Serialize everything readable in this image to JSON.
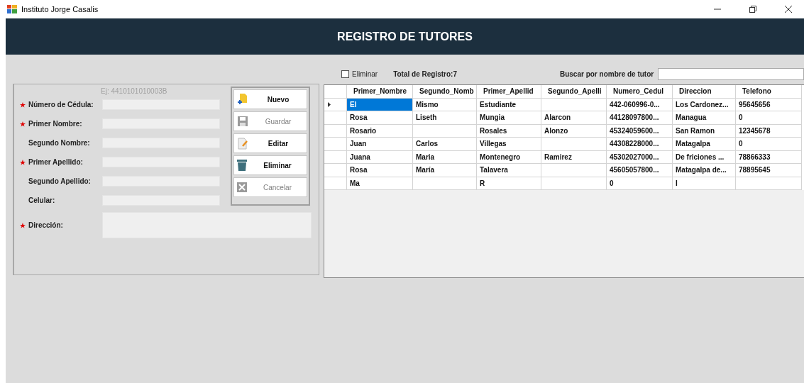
{
  "window": {
    "title": "Instituto Jorge Casalis"
  },
  "header": {
    "title": "REGISTRO DE TUTORES"
  },
  "form": {
    "fields": [
      {
        "label": "Número de Cédula:",
        "required": true,
        "hint": "Ej: 4410101010003B"
      },
      {
        "label": "Primer Nombre:",
        "required": true
      },
      {
        "label": "Segundo Nombre:",
        "required": false
      },
      {
        "label": "Primer Apellido:",
        "required": true
      },
      {
        "label": "Segundo Apellido:",
        "required": false
      },
      {
        "label": "Celular:",
        "required": false
      },
      {
        "label": "Dirección:",
        "required": true,
        "kind": "multiline"
      }
    ],
    "buttons": [
      {
        "label": "Nuevo",
        "kind": "new",
        "disabled": false
      },
      {
        "label": "Guardar",
        "kind": "save",
        "disabled": true
      },
      {
        "label": "Editar",
        "kind": "edit",
        "disabled": false
      },
      {
        "label": "Eliminar",
        "kind": "delete",
        "disabled": false
      },
      {
        "label": "Cancelar",
        "kind": "cancel",
        "disabled": true
      }
    ]
  },
  "toolbar": {
    "delete_checkbox": {
      "label": "Eliminar",
      "checked": false
    },
    "total": "Total de Registro:7",
    "search": {
      "label": "Buscar por nombre de tutor"
    }
  },
  "table": {
    "columns": [
      "Primer_Nombre",
      "Segundo_Nomb",
      "Primer_Apellid",
      "Segundo_Apelli",
      "Numero_Cedul",
      "Direccion",
      "Telefono"
    ],
    "rows": [
      {
        "selected": true,
        "cells": [
          "El",
          "Mismo",
          "Estudiante",
          "",
          "442-060996-0...",
          "Los Cardonez...",
          "95645656"
        ]
      },
      {
        "selected": false,
        "cells": [
          "Rosa",
          "Liseth",
          "Mungia",
          "Alarcon",
          "44128097800...",
          "Managua",
          "0"
        ]
      },
      {
        "selected": false,
        "cells": [
          "Rosario",
          "",
          "Rosales",
          "Alonzo",
          "45324059600...",
          "San Ramon",
          "12345678"
        ]
      },
      {
        "selected": false,
        "cells": [
          "Juan",
          "Carlos",
          "Villegas",
          "",
          "44308228000...",
          "Matagalpa",
          "0"
        ]
      },
      {
        "selected": false,
        "cells": [
          "Juana",
          "Maria",
          "Montenegro",
          "Ramirez",
          "45302027000...",
          "De friciones ...",
          "78866333"
        ]
      },
      {
        "selected": false,
        "cells": [
          "Rosa",
          "María",
          "Talavera",
          "",
          "45605057800...",
          "Matagalpa de...",
          "78895645"
        ]
      },
      {
        "selected": false,
        "cells": [
          "Ma",
          "",
          "R",
          "",
          "0",
          "I",
          ""
        ]
      }
    ]
  }
}
